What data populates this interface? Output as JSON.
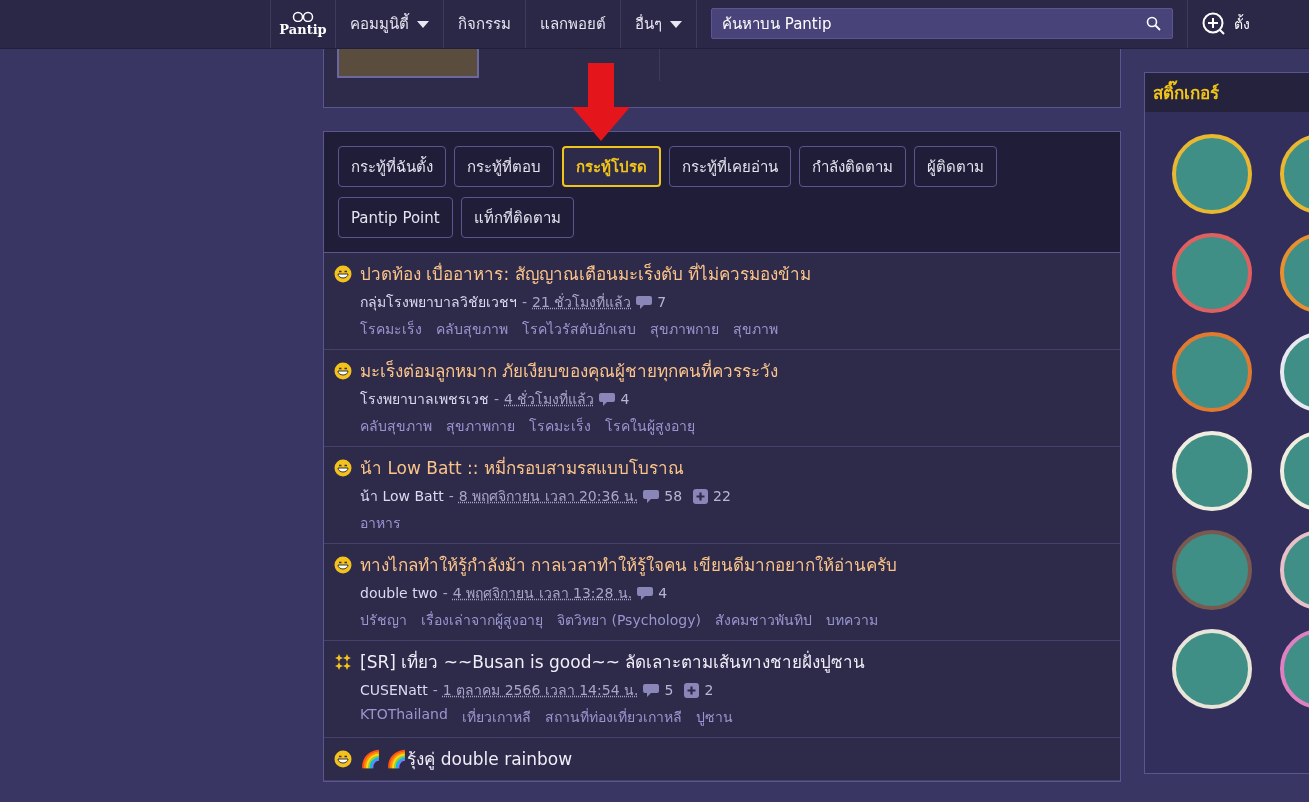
{
  "nav": {
    "logo": "Pantip",
    "items": [
      {
        "label": "คอมมูนิตี้",
        "dropdown": true
      },
      {
        "label": "กิจกรรม",
        "dropdown": false
      },
      {
        "label": "แลกพอยต์",
        "dropdown": false
      },
      {
        "label": "อื่นๆ",
        "dropdown": true
      }
    ],
    "search": {
      "placeholder": "ค้นหาบน Pantip"
    },
    "new_topic": "ตั้ง"
  },
  "tabs": [
    {
      "label": "กระทู้ที่ฉันตั้ง",
      "selected": false
    },
    {
      "label": "กระทู้ที่ตอบ",
      "selected": false
    },
    {
      "label": "กระทู้โปรด",
      "selected": true
    },
    {
      "label": "กระทู้ที่เคยอ่าน",
      "selected": false
    },
    {
      "label": "กำลังติดตาม",
      "selected": false
    },
    {
      "label": "ผู้ติดตาม",
      "selected": false
    },
    {
      "label": "Pantip Point",
      "selected": false
    },
    {
      "label": "แท็กที่ติดตาม",
      "selected": false
    }
  ],
  "topics": [
    {
      "kind": "smile",
      "read": true,
      "title": "ปวดท้อง เบื่ออาหาร: สัญญาณเตือนมะเร็งตับ ที่ไม่ควรมองข้าม",
      "author": "กลุ่มโรงพยาบาลวิชัยเวชฯ",
      "separator": "-",
      "time": "21 ชั่วโมงที่แล้ว",
      "comments": "7",
      "tags": [
        "โรคมะเร็ง",
        "คลับสุขภาพ",
        "โรคไวรัสตับอักเสบ",
        "สุขภาพกาย",
        "สุขภาพ"
      ]
    },
    {
      "kind": "smile",
      "read": true,
      "title": "มะเร็งต่อมลูกหมาก ภัยเงียบของคุณผู้ชายทุกคนที่ควรระวัง",
      "author": "โรงพยาบาลเพชรเวช",
      "separator": "-",
      "time": "4 ชั่วโมงที่แล้ว",
      "comments": "4",
      "tags": [
        "คลับสุขภาพ",
        "สุขภาพกาย",
        "โรคมะเร็ง",
        "โรคในผู้สูงอายุ"
      ]
    },
    {
      "kind": "smile",
      "read": true,
      "title": "น้า Low Batt :: หมี่กรอบสามรสแบบโบราณ",
      "author": "น้า Low Batt",
      "separator": "-",
      "time": "8 พฤศจิกายน เวลา 20:36 น.",
      "comments": "58",
      "votes": "22",
      "tags": [
        "อาหาร"
      ]
    },
    {
      "kind": "smile",
      "read": true,
      "title": "ทางไกลทำให้รู้กำลังม้า กาลเวลาทำให้รู้ใจคน เขียนดีมากอยากให้อ่านครับ",
      "author": "double two",
      "separator": "-",
      "time": "4 พฤศจิกายน เวลา 13:28 น.",
      "comments": "4",
      "tags": [
        "ปรัชญา",
        "เรื่องเล่าจากผู้สูงอายุ",
        "จิตวิทยา (Psychology)",
        "สังคมชาวพันทิป",
        "บทความ"
      ]
    },
    {
      "kind": "stars",
      "read": false,
      "title": "[SR] เที่ยว ~~Busan is good~~ ลัดเลาะตามเส้นทางชายฝั่งปูซาน",
      "author": "CUSENatt",
      "separator": "-",
      "time": "1 ตุลาคม 2566 เวลา 14:54 น.",
      "comments": "5",
      "votes": "2",
      "tags": [
        "KTOThailand",
        "เที่ยวเกาหลี",
        "สถานที่ท่องเที่ยวเกาหลี",
        "ปูซาน"
      ]
    },
    {
      "kind": "smile",
      "read": false,
      "title": "🌈 🌈รุ้งคู่ double rainbow"
    }
  ],
  "stickers": {
    "title": "สติ๊กเกอร์",
    "items": [
      {
        "color": "#e8b830"
      },
      {
        "color": "#e8b830"
      },
      {
        "color": "#e06060"
      },
      {
        "color": "#e89030"
      },
      {
        "color": "#e07a30"
      },
      {
        "color": "#e8e8f0"
      },
      {
        "color": "#f0ece0"
      },
      {
        "color": "#f0ece0"
      },
      {
        "color": "#7a5a50"
      },
      {
        "color": "#e8c0c8"
      },
      {
        "color": "#e8e4d8"
      },
      {
        "color": "#e080c0"
      }
    ]
  }
}
